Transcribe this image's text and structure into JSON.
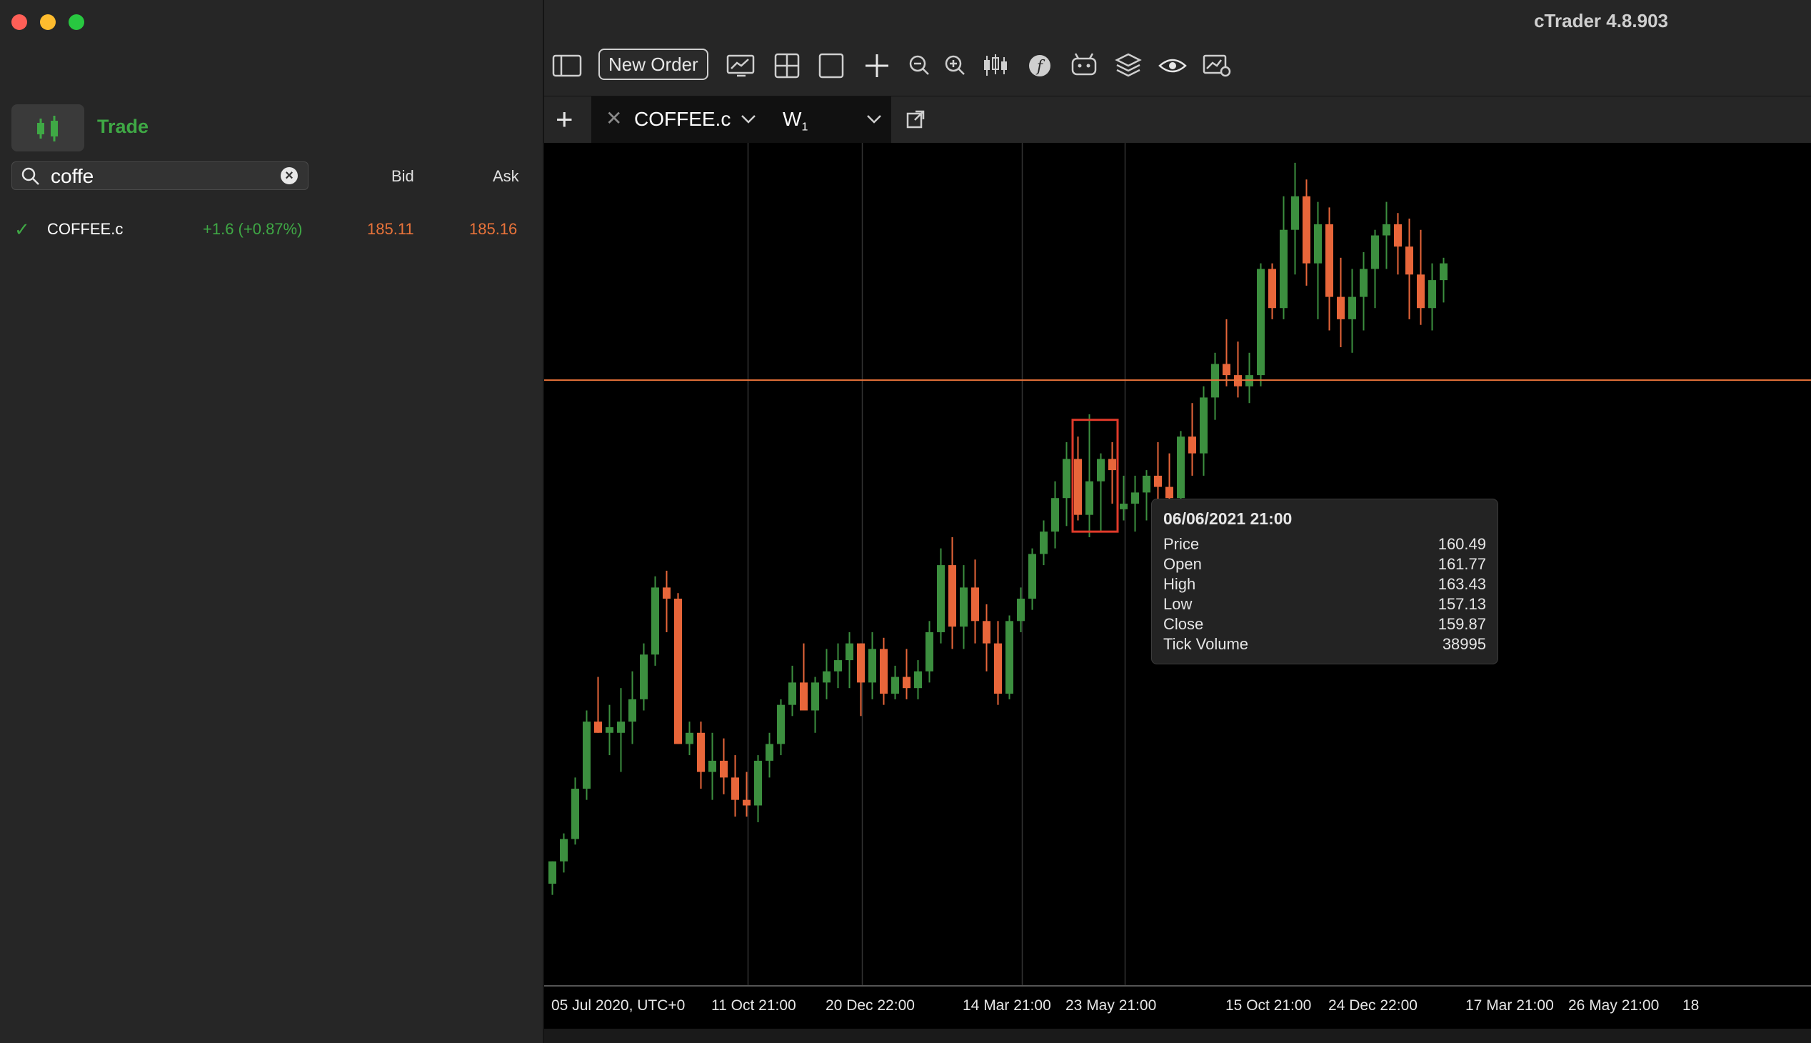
{
  "app": {
    "title": "cTrader 4.8.903"
  },
  "sidebar": {
    "tab_label": "Trade",
    "search": {
      "value": "coffe"
    },
    "columns": {
      "bid": "Bid",
      "ask": "Ask"
    },
    "rows": [
      {
        "symbol": "COFFEE.c",
        "change": "+1.6 (+0.87%)",
        "bid": "185.11",
        "ask": "185.16"
      }
    ]
  },
  "toolbar": {
    "new_order_label": "New Order"
  },
  "tab": {
    "symbol": "COFFEE.c",
    "timeframe": "W",
    "timeframe_sub": "1"
  },
  "colors": {
    "bull": "#3c8f3f",
    "bear": "#e8663a",
    "price_line": "#e8733a",
    "highlight": "#e03a2a"
  },
  "tooltip": {
    "date": "06/06/2021 21:00",
    "rows": [
      {
        "label": "Price",
        "value": "160.49"
      },
      {
        "label": "Open",
        "value": "161.77"
      },
      {
        "label": "High",
        "value": "163.43"
      },
      {
        "label": "Low",
        "value": "157.13"
      },
      {
        "label": "Close",
        "value": "159.87"
      },
      {
        "label": "Tick Volume",
        "value": "38995"
      }
    ]
  },
  "chart_data": {
    "type": "candlestick",
    "symbol": "COFFEE.c",
    "timeframe": "W1",
    "current_price": 185.11,
    "x_ticks": [
      "05 Jul 2020, UTC+0",
      "11 Oct 21:00",
      "20 Dec 22:00",
      "14 Mar 21:00",
      "23 May 21:00",
      "15 Oct 21:00",
      "24 Dec 22:00",
      "17 Mar 21:00",
      "26 May 21:00",
      "18"
    ],
    "x_tick_positions": [
      0,
      14,
      24,
      36,
      45,
      59,
      68,
      80,
      89,
      99
    ],
    "ylim": [
      78,
      225
    ],
    "candles": [
      [
        95,
        99,
        93,
        99
      ],
      [
        99,
        104,
        97,
        103
      ],
      [
        103,
        114,
        102,
        112
      ],
      [
        112,
        126,
        110,
        124
      ],
      [
        124,
        132,
        122,
        122
      ],
      [
        122,
        127,
        118,
        123
      ],
      [
        122,
        130,
        115,
        124
      ],
      [
        124,
        133,
        120,
        128
      ],
      [
        128,
        138,
        126,
        136
      ],
      [
        136,
        150,
        134,
        148
      ],
      [
        148,
        151,
        140,
        146
      ],
      [
        146,
        147,
        120,
        120
      ],
      [
        120,
        124,
        118,
        122
      ],
      [
        122,
        124,
        112,
        115
      ],
      [
        115,
        122,
        110,
        117
      ],
      [
        117,
        121,
        111,
        114
      ],
      [
        114,
        118,
        107,
        110
      ],
      [
        110,
        115,
        107,
        109
      ],
      [
        109,
        118,
        106,
        117
      ],
      [
        117,
        122,
        114,
        120
      ],
      [
        120,
        128,
        118,
        127
      ],
      [
        127,
        134,
        125,
        131
      ],
      [
        131,
        138,
        128,
        126
      ],
      [
        126,
        132,
        122,
        131
      ],
      [
        131,
        137,
        128,
        133
      ],
      [
        133,
        138,
        130,
        135
      ],
      [
        135,
        140,
        130,
        138
      ],
      [
        138,
        138,
        125,
        131
      ],
      [
        131,
        140,
        128,
        137
      ],
      [
        137,
        139,
        127,
        129
      ],
      [
        129,
        134,
        128,
        132
      ],
      [
        132,
        137,
        128,
        130
      ],
      [
        130,
        135,
        128,
        133
      ],
      [
        133,
        142,
        131,
        140
      ],
      [
        140,
        155,
        138,
        152
      ],
      [
        152,
        157,
        137,
        141
      ],
      [
        141,
        152,
        137,
        148
      ],
      [
        148,
        153,
        138,
        142
      ],
      [
        142,
        145,
        133,
        138
      ],
      [
        138,
        142,
        127,
        129
      ],
      [
        129,
        143,
        128,
        142
      ],
      [
        142,
        148,
        140,
        146
      ],
      [
        146,
        155,
        144,
        154
      ],
      [
        154,
        160,
        152,
        158
      ],
      [
        158,
        167,
        155,
        164
      ],
      [
        164,
        174,
        159,
        171
      ],
      [
        171,
        175,
        160,
        161
      ],
      [
        161,
        179,
        157,
        167
      ],
      [
        167,
        172,
        158,
        171
      ],
      [
        171,
        174,
        163,
        169
      ],
      [
        162,
        168,
        160,
        163
      ],
      [
        163,
        168,
        158,
        165
      ],
      [
        165,
        169,
        160,
        168
      ],
      [
        168,
        174,
        162,
        166
      ],
      [
        166,
        172,
        160,
        164
      ],
      [
        164,
        176,
        162,
        175
      ],
      [
        175,
        181,
        168,
        172
      ],
      [
        172,
        184,
        168,
        182
      ],
      [
        182,
        190,
        178,
        188
      ],
      [
        188,
        196,
        184,
        186
      ],
      [
        186,
        192,
        182,
        184
      ],
      [
        184,
        190,
        181,
        186
      ],
      [
        186,
        206,
        184,
        205
      ],
      [
        205,
        206,
        196,
        198
      ],
      [
        198,
        218,
        196,
        212
      ],
      [
        212,
        224,
        204,
        218
      ],
      [
        218,
        221,
        202,
        206
      ],
      [
        206,
        217,
        196,
        213
      ],
      [
        213,
        216,
        194,
        200
      ],
      [
        200,
        207,
        191,
        196
      ],
      [
        196,
        205,
        190,
        200
      ],
      [
        200,
        208,
        194,
        205
      ],
      [
        205,
        212,
        198,
        211
      ],
      [
        211,
        217,
        205,
        213
      ],
      [
        213,
        215,
        204,
        209
      ],
      [
        209,
        214,
        196,
        204
      ],
      [
        204,
        212,
        195,
        198
      ],
      [
        198,
        206,
        194,
        203
      ],
      [
        203,
        207,
        199,
        206
      ]
    ]
  }
}
